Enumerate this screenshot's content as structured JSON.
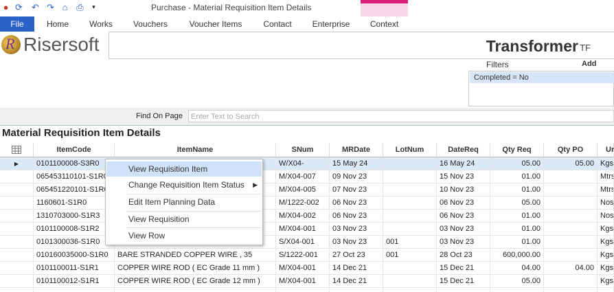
{
  "window": {
    "title": "Purchase - Material Requisition Item Details"
  },
  "quick_access": [
    "app-icon",
    "refresh-icon",
    "undo-icon",
    "redo-icon",
    "home-icon",
    "print-icon",
    "dropdown-arrow-icon"
  ],
  "tabs": {
    "file": "File",
    "items": [
      "Home",
      "Works",
      "Vouchers",
      "Voucher Items",
      "Contact",
      "Enterprise",
      "Context"
    ]
  },
  "header": {
    "logo_text": "Risersoft",
    "logo_letter": "R",
    "company": "Transformer",
    "company_suffix": "TF"
  },
  "filters": {
    "label": "Filters",
    "add_label": "Add",
    "items": [
      "Completed = No"
    ]
  },
  "find": {
    "label": "Find On Page",
    "placeholder": "Enter Text to Search"
  },
  "section": {
    "title": "Material Requisition Item Details"
  },
  "grid": {
    "columns": [
      "ItemCode",
      "ItemName",
      "SNum",
      "MRDate",
      "LotNum",
      "DateReq",
      "Qty Req",
      "Qty PO",
      "Ur"
    ],
    "rows": [
      [
        "0101100008-S3R0",
        "",
        "W/X04-",
        "15 May 24",
        "",
        "16 May 24",
        "05.00",
        "05.00",
        "Kgs"
      ],
      [
        "065453110101-S1R0",
        "",
        "M/X04-007",
        "09 Nov 23",
        "",
        "15 Nov 23",
        "01.00",
        "",
        "Mtrs"
      ],
      [
        "065451220101-S1R0",
        "",
        "M/X04-005",
        "07 Nov 23",
        "",
        "10 Nov 23",
        "01.00",
        "",
        "Mtrs"
      ],
      [
        "1160601-S1R0",
        "",
        "M/1222-002",
        "06 Nov 23",
        "",
        "06 Nov 23",
        "05.00",
        "",
        "Nos"
      ],
      [
        "1310703000-S1R3",
        "",
        "M/X04-002",
        "06 Nov 23",
        "",
        "06 Nov 23",
        "01.00",
        "",
        "Nos"
      ],
      [
        "0101100008-S1R2",
        "",
        "M/X04-001",
        "03 Nov 23",
        "",
        "03 Nov 23",
        "01.00",
        "",
        "Kgs"
      ],
      [
        "0101300036-S1R0",
        "",
        "S/X04-001",
        "03 Nov 23",
        "001",
        "03 Nov 23",
        "01.00",
        "",
        "Kgs"
      ],
      [
        "010160035000-S1R0",
        "BARE STRANDED COPPER WIRE , 35",
        "S/1222-001",
        "27 Oct 23",
        "001",
        "28 Oct 23",
        "600,000.00",
        "",
        "Kgs"
      ],
      [
        "0101100011-S1R1",
        "COPPER WIRE ROD ( EC Grade 11 mm )",
        "M/X04-001",
        "14 Dec 21",
        "",
        "15 Dec 21",
        "04.00",
        "04.00",
        "Kgs"
      ],
      [
        "0101100012-S1R1",
        "COPPER WIRE ROD ( EC Grade 12 mm )",
        "M/X04-001",
        "14 Dec 21",
        "",
        "15 Dec 21",
        "05.00",
        "",
        "Kgs"
      ],
      [
        "",
        "",
        "",
        "",
        "",
        "",
        "",
        "",
        ""
      ]
    ]
  },
  "context_menu": {
    "items": [
      "View Requisition Item",
      "Change Requisition Item Status",
      "Edit Item Planning Data",
      "View Requisition",
      "View Row"
    ]
  }
}
